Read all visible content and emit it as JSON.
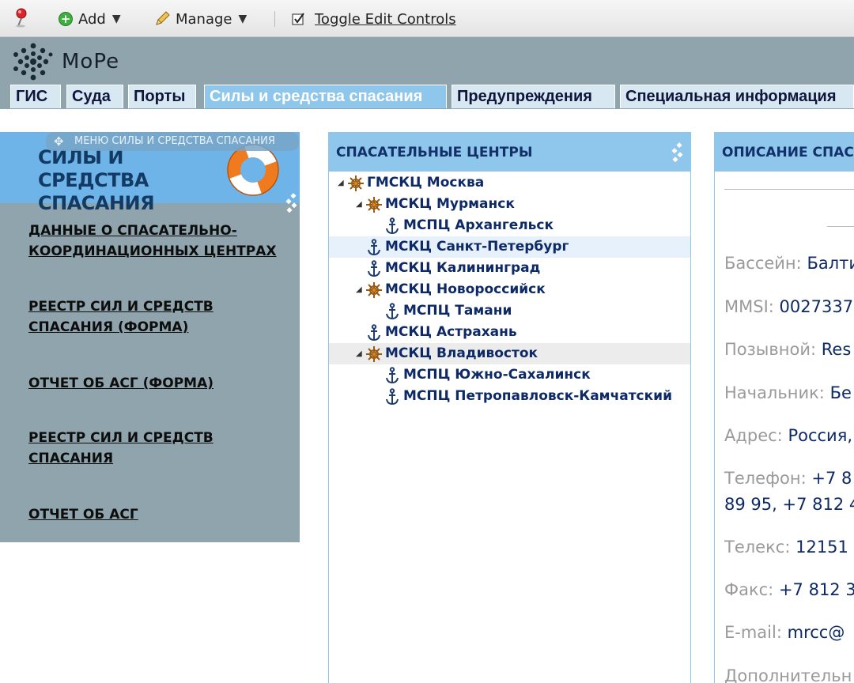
{
  "toolbar": {
    "add_label": "Add",
    "manage_label": "Manage",
    "toggle_label": "Toggle Edit Controls"
  },
  "logo": {
    "text": "MoPe"
  },
  "tabs": [
    {
      "label": "ГИС",
      "active": false
    },
    {
      "label": "Суда",
      "active": false
    },
    {
      "label": "Порты",
      "active": false
    },
    {
      "label": "Силы и средства спасания",
      "active": true
    },
    {
      "label": "Предупреждения",
      "active": false
    },
    {
      "label": "Специальная информация",
      "active": false
    }
  ],
  "left_panel": {
    "caption": "МЕНЮ СИЛЫ И СРЕДСТВА СПАСАНИЯ",
    "title_line1": "СИЛЫ И СРЕДСТВА",
    "title_line2": "СПАСАНИЯ",
    "items": [
      {
        "line1": "ДАННЫЕ О СПАСАТЕЛЬНО-",
        "line2": "КООРДИНАЦИОННЫХ ЦЕНТРАХ"
      },
      {
        "line1": "РЕЕСТР СИЛ И СРЕДСТВ",
        "line2": "СПАСАНИЯ (ФОРМА)"
      },
      {
        "line1": "ОТЧЕТ ОБ АСГ (ФОРМА)",
        "line2": ""
      },
      {
        "line1": "РЕЕСТР СИЛ И СРЕДСТВ",
        "line2": "СПАСАНИЯ"
      },
      {
        "line1": "ОТЧЕТ ОБ АСГ",
        "line2": ""
      }
    ]
  },
  "center_panel": {
    "title": "СПАСАТЕЛЬНЫЕ ЦЕНТРЫ",
    "tree": [
      {
        "label": "ГМСКЦ Москва",
        "icon": "helm-icon",
        "expanded": true
      },
      {
        "label": "МСКЦ Мурманск",
        "icon": "helm-icon",
        "expanded": true
      },
      {
        "label": "МСПЦ Архангельск",
        "icon": "anchor-icon"
      },
      {
        "label": "МСКЦ Санкт-Петербург",
        "icon": "anchor-icon",
        "selected": true
      },
      {
        "label": "МСКЦ Калининград",
        "icon": "anchor-icon"
      },
      {
        "label": "МСКЦ Новороссийск",
        "icon": "helm-icon",
        "expanded": true
      },
      {
        "label": "МСПЦ Тамани",
        "icon": "anchor-icon"
      },
      {
        "label": "МСКЦ Астрахань",
        "icon": "anchor-icon"
      },
      {
        "label": "МСКЦ Владивосток",
        "icon": "helm-icon",
        "expanded": true,
        "hovered": true
      },
      {
        "label": "МСПЦ Южно-Сахалинск",
        "icon": "anchor-icon"
      },
      {
        "label": "МСПЦ Петропавловск-Камчатский",
        "icon": "anchor-icon"
      }
    ]
  },
  "right_panel": {
    "title": "ОПИСАНИЕ СПАСА",
    "fields": [
      {
        "key": "Бассейн:",
        "value": "Балти"
      },
      {
        "key": "MMSI:",
        "value": "0027337"
      },
      {
        "key": "Позывной:",
        "value": "Res"
      },
      {
        "key": "Начальник:",
        "value": "Бе"
      },
      {
        "key": "Адрес:",
        "value": "Россия,"
      },
      {
        "key": "Телефон:",
        "value": "+7 8",
        "value2": "89 95, +7 812 4"
      },
      {
        "key": "Телекс:",
        "value": "12151"
      },
      {
        "key": "Факс:",
        "value": "+7 812 3"
      },
      {
        "key": "E-mail:",
        "value": "mrcc@"
      },
      {
        "key": "Дополнительн",
        "value": ""
      }
    ]
  },
  "colors": {
    "header_bg": "#8fa4ad",
    "tab_bg": "#d8e8f3",
    "tab_active_bg": "#8fc6ec",
    "panel_head": "#8fc6ec",
    "left_head": "#6fb4e8",
    "link_text": "#0d2a66"
  }
}
